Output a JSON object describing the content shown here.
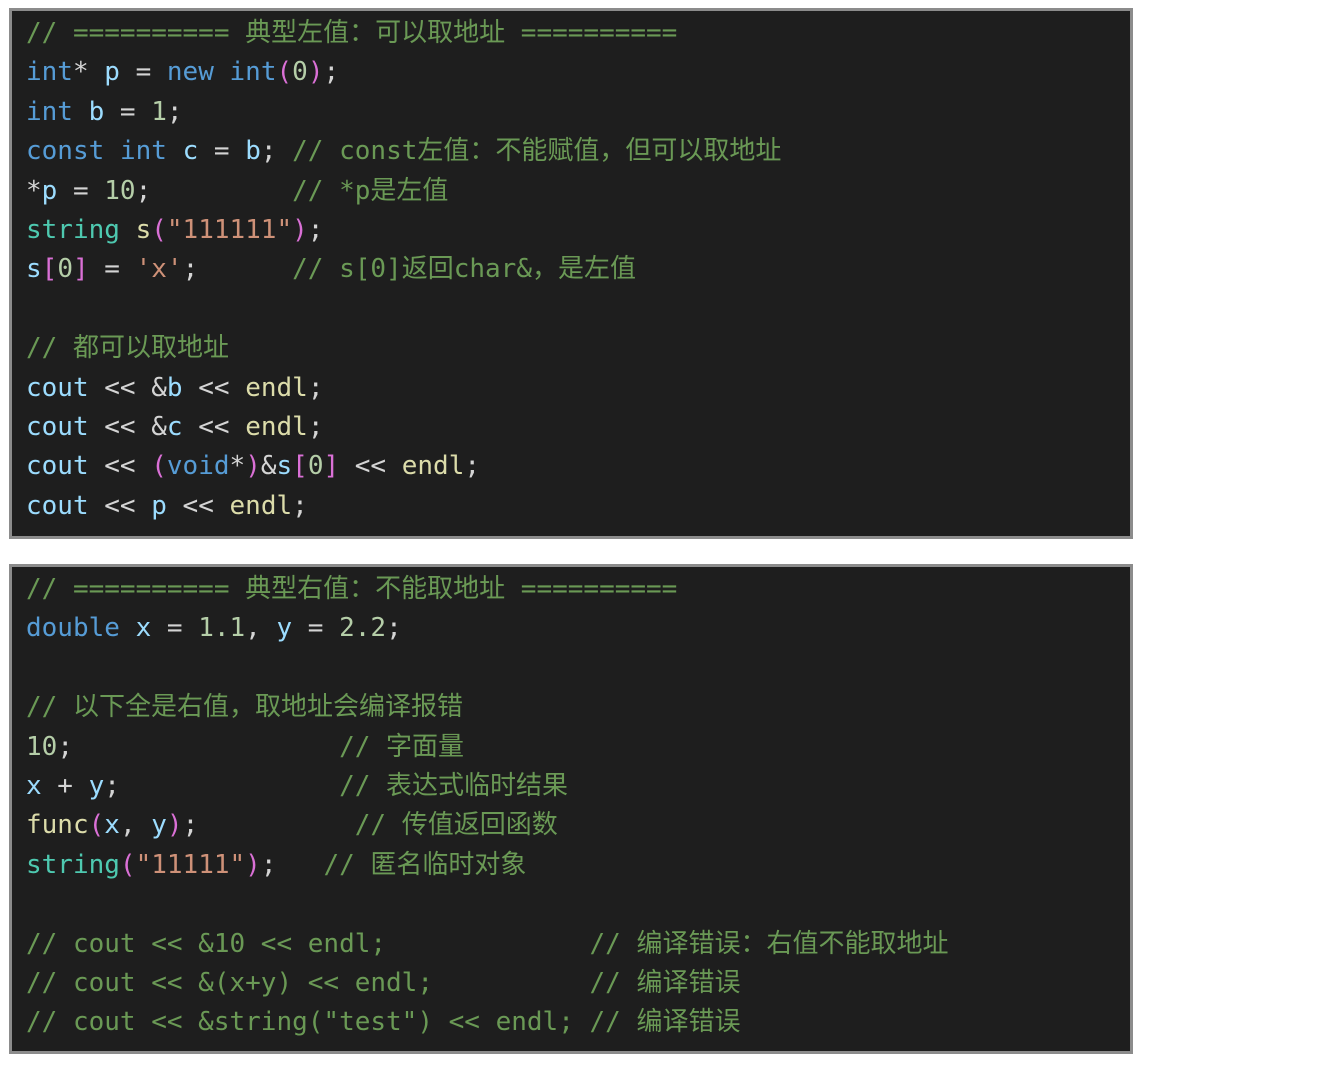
{
  "colors": {
    "background": "#1e1e1e",
    "border": "#8c8c8c",
    "keyword": "#569cd6",
    "type": "#4ec9b0",
    "variable": "#9cdcfe",
    "number": "#b5cea8",
    "string": "#ce9178",
    "function": "#dcdcaa",
    "comment": "#6a9955",
    "paren": "#da70d6",
    "default": "#d4d4d4"
  },
  "panels": [
    {
      "lines": [
        [
          {
            "c": "cm",
            "t": "// ========== 典型左值：可以取地址 =========="
          }
        ],
        [
          {
            "c": "kw",
            "t": "int"
          },
          {
            "c": "op",
            "t": "* "
          },
          {
            "c": "va",
            "t": "p"
          },
          {
            "c": "op",
            "t": " = "
          },
          {
            "c": "kw",
            "t": "new"
          },
          {
            "c": "op",
            "t": " "
          },
          {
            "c": "kw",
            "t": "int"
          },
          {
            "c": "pn",
            "t": "("
          },
          {
            "c": "nu",
            "t": "0"
          },
          {
            "c": "pn",
            "t": ")"
          },
          {
            "c": "op",
            "t": ";"
          }
        ],
        [
          {
            "c": "kw",
            "t": "int"
          },
          {
            "c": "op",
            "t": " "
          },
          {
            "c": "va",
            "t": "b"
          },
          {
            "c": "op",
            "t": " = "
          },
          {
            "c": "nu",
            "t": "1"
          },
          {
            "c": "op",
            "t": ";"
          }
        ],
        [
          {
            "c": "kw",
            "t": "const"
          },
          {
            "c": "op",
            "t": " "
          },
          {
            "c": "kw",
            "t": "int"
          },
          {
            "c": "op",
            "t": " "
          },
          {
            "c": "va",
            "t": "c"
          },
          {
            "c": "op",
            "t": " = "
          },
          {
            "c": "va",
            "t": "b"
          },
          {
            "c": "op",
            "t": "; "
          },
          {
            "c": "cm",
            "t": "// const左值：不能赋值，但可以取地址"
          }
        ],
        [
          {
            "c": "op",
            "t": "*"
          },
          {
            "c": "va",
            "t": "p"
          },
          {
            "c": "op",
            "t": " = "
          },
          {
            "c": "nu",
            "t": "10"
          },
          {
            "c": "op",
            "t": ";         "
          },
          {
            "c": "cm",
            "t": "// *p是左值"
          }
        ],
        [
          {
            "c": "ty",
            "t": "string"
          },
          {
            "c": "op",
            "t": " "
          },
          {
            "c": "fn",
            "t": "s"
          },
          {
            "c": "pn",
            "t": "("
          },
          {
            "c": "st",
            "t": "\"111111\""
          },
          {
            "c": "pn",
            "t": ")"
          },
          {
            "c": "op",
            "t": ";"
          }
        ],
        [
          {
            "c": "va",
            "t": "s"
          },
          {
            "c": "pn",
            "t": "["
          },
          {
            "c": "nu",
            "t": "0"
          },
          {
            "c": "pn",
            "t": "]"
          },
          {
            "c": "op",
            "t": " = "
          },
          {
            "c": "st",
            "t": "'x'"
          },
          {
            "c": "op",
            "t": ";      "
          },
          {
            "c": "cm",
            "t": "// s[0]返回char&，是左值"
          }
        ],
        [],
        [
          {
            "c": "cm",
            "t": "// 都可以取地址"
          }
        ],
        [
          {
            "c": "va",
            "t": "cout"
          },
          {
            "c": "op",
            "t": " << &"
          },
          {
            "c": "va",
            "t": "b"
          },
          {
            "c": "op",
            "t": " << "
          },
          {
            "c": "fn",
            "t": "endl"
          },
          {
            "c": "op",
            "t": ";"
          }
        ],
        [
          {
            "c": "va",
            "t": "cout"
          },
          {
            "c": "op",
            "t": " << &"
          },
          {
            "c": "va",
            "t": "c"
          },
          {
            "c": "op",
            "t": " << "
          },
          {
            "c": "fn",
            "t": "endl"
          },
          {
            "c": "op",
            "t": ";"
          }
        ],
        [
          {
            "c": "va",
            "t": "cout"
          },
          {
            "c": "op",
            "t": " << "
          },
          {
            "c": "pn",
            "t": "("
          },
          {
            "c": "kw",
            "t": "void"
          },
          {
            "c": "op",
            "t": "*"
          },
          {
            "c": "pn",
            "t": ")"
          },
          {
            "c": "op",
            "t": "&"
          },
          {
            "c": "va",
            "t": "s"
          },
          {
            "c": "pn",
            "t": "["
          },
          {
            "c": "nu",
            "t": "0"
          },
          {
            "c": "pn",
            "t": "]"
          },
          {
            "c": "op",
            "t": " << "
          },
          {
            "c": "fn",
            "t": "endl"
          },
          {
            "c": "op",
            "t": ";"
          }
        ],
        [
          {
            "c": "va",
            "t": "cout"
          },
          {
            "c": "op",
            "t": " << "
          },
          {
            "c": "va",
            "t": "p"
          },
          {
            "c": "op",
            "t": " << "
          },
          {
            "c": "fn",
            "t": "endl"
          },
          {
            "c": "op",
            "t": ";"
          }
        ]
      ]
    },
    {
      "lines": [
        [
          {
            "c": "cm",
            "t": "// ========== 典型右值：不能取地址 =========="
          }
        ],
        [
          {
            "c": "kw",
            "t": "double"
          },
          {
            "c": "op",
            "t": " "
          },
          {
            "c": "va",
            "t": "x"
          },
          {
            "c": "op",
            "t": " = "
          },
          {
            "c": "nu",
            "t": "1.1"
          },
          {
            "c": "op",
            "t": ", "
          },
          {
            "c": "va",
            "t": "y"
          },
          {
            "c": "op",
            "t": " = "
          },
          {
            "c": "nu",
            "t": "2.2"
          },
          {
            "c": "op",
            "t": ";"
          }
        ],
        [],
        [
          {
            "c": "cm",
            "t": "// 以下全是右值，取地址会编译报错"
          }
        ],
        [
          {
            "c": "nu",
            "t": "10"
          },
          {
            "c": "op",
            "t": ";                 "
          },
          {
            "c": "cm",
            "t": "// 字面量"
          }
        ],
        [
          {
            "c": "va",
            "t": "x"
          },
          {
            "c": "op",
            "t": " + "
          },
          {
            "c": "va",
            "t": "y"
          },
          {
            "c": "op",
            "t": ";              "
          },
          {
            "c": "cm",
            "t": "// 表达式临时结果"
          }
        ],
        [
          {
            "c": "fn",
            "t": "func"
          },
          {
            "c": "pn",
            "t": "("
          },
          {
            "c": "va",
            "t": "x"
          },
          {
            "c": "op",
            "t": ", "
          },
          {
            "c": "va",
            "t": "y"
          },
          {
            "c": "pn",
            "t": ")"
          },
          {
            "c": "op",
            "t": ";          "
          },
          {
            "c": "cm",
            "t": "// 传值返回函数"
          }
        ],
        [
          {
            "c": "ty",
            "t": "string"
          },
          {
            "c": "pn",
            "t": "("
          },
          {
            "c": "st",
            "t": "\"11111\""
          },
          {
            "c": "pn",
            "t": ")"
          },
          {
            "c": "op",
            "t": ";   "
          },
          {
            "c": "cm",
            "t": "// 匿名临时对象"
          }
        ],
        [],
        [
          {
            "c": "cm",
            "t": "// cout << &10 << endl;             // 编译错误：右值不能取地址"
          }
        ],
        [
          {
            "c": "cm",
            "t": "// cout << &(x+y) << endl;          // 编译错误"
          }
        ],
        [
          {
            "c": "cm",
            "t": "// cout << &string(\"test\") << endl; // 编译错误"
          }
        ]
      ]
    }
  ]
}
